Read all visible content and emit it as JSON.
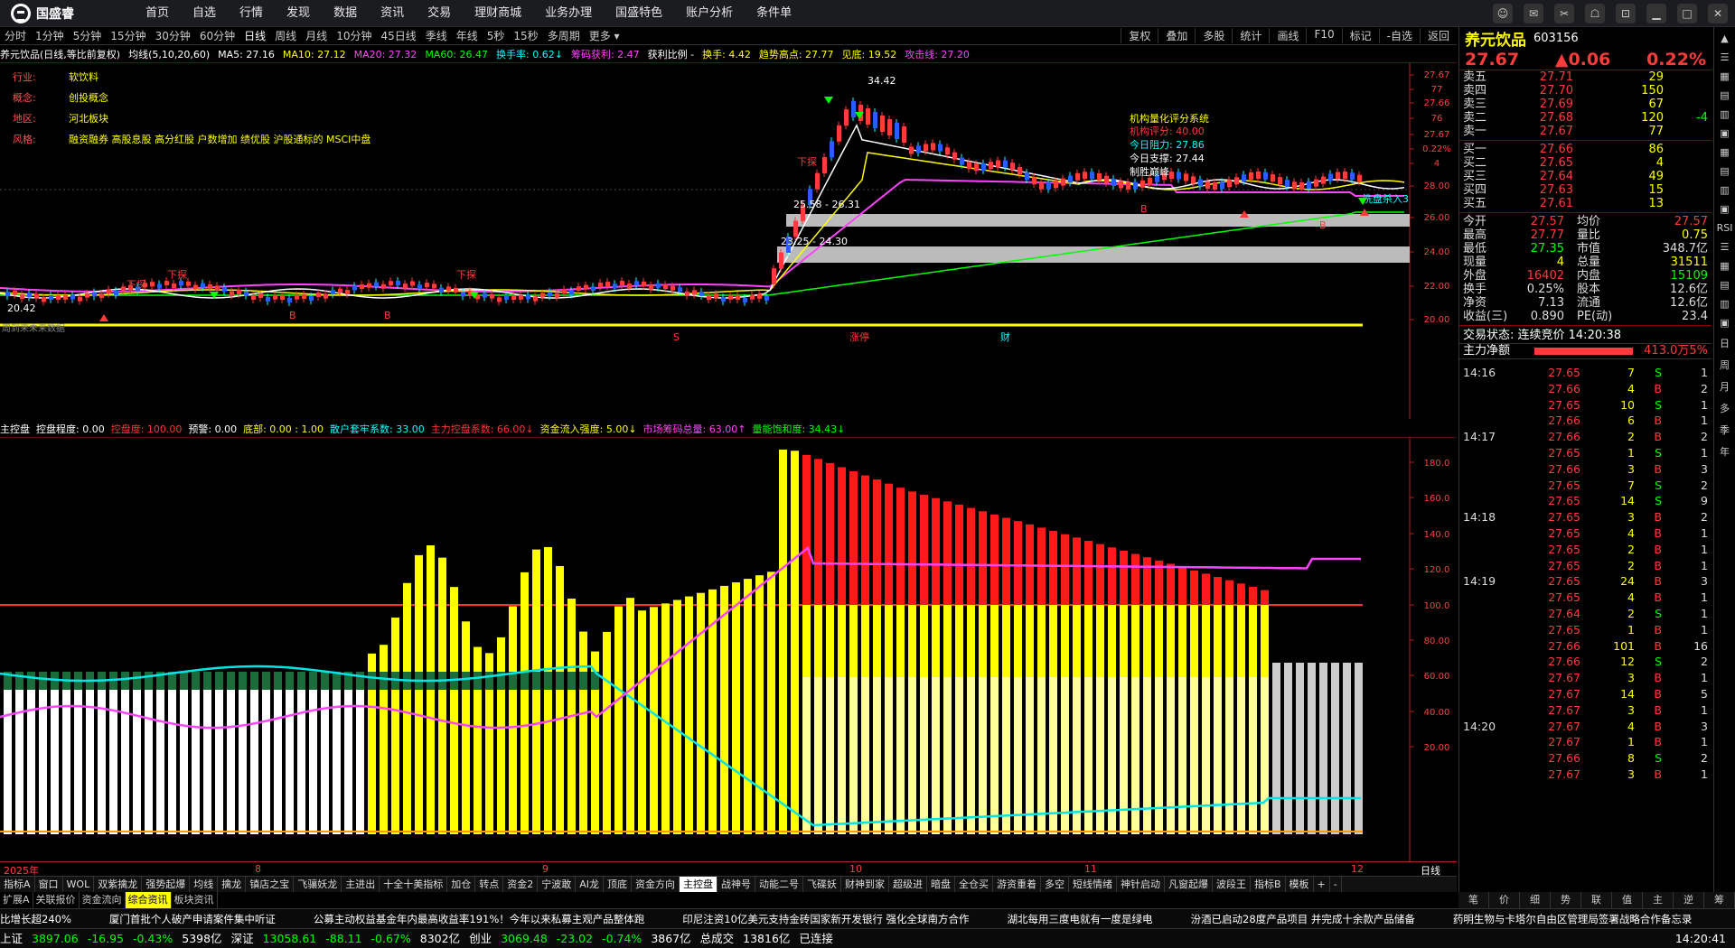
{
  "app": {
    "logo": "国盛睿",
    "menu": [
      "首页",
      "自选",
      "行情",
      "发现",
      "数据",
      "资讯",
      "交易",
      "理财商城",
      "业务办理",
      "国盛特色",
      "账户分析",
      "条件单"
    ]
  },
  "periods": {
    "left": [
      "分时",
      "1分钟",
      "5分钟",
      "15分钟",
      "30分钟",
      "60分钟",
      "日线",
      "周线",
      "月线",
      "10分钟",
      "45日线",
      "季线",
      "年线",
      "5秒",
      "15秒",
      "多周期",
      "更多 ▾"
    ],
    "active": "日线",
    "right": [
      "复权",
      "叠加",
      "多股",
      "统计",
      "画线",
      "F10",
      "标记",
      "-自选",
      "返回"
    ]
  },
  "kinfo": [
    {
      "t": "养元饮品(日线,等比前复权)",
      "c": "#ffffff"
    },
    {
      "t": "均线(5,10,20,60)",
      "c": "#ffffff"
    },
    {
      "t": "MA5: 27.16",
      "c": "#ffffff"
    },
    {
      "t": "MA10: 27.12",
      "c": "#ffff00"
    },
    {
      "t": "MA20: 27.32",
      "c": "#ff44ff"
    },
    {
      "t": "MA60: 26.47",
      "c": "#00ff00"
    },
    {
      "t": "换手率: 0.62↓",
      "c": "#00ffff"
    },
    {
      "t": "筹码获利: 2.47",
      "c": "#ff44ff"
    },
    {
      "t": "获利比例 -",
      "c": "#ffffff"
    },
    {
      "t": "换手: 4.42",
      "c": "#ffff00"
    },
    {
      "t": "趋势高点: 27.77",
      "c": "#ffff00"
    },
    {
      "t": "见底: 19.52",
      "c": "#ffff00"
    },
    {
      "t": "攻击线: 27.20",
      "c": "#ff44ff"
    }
  ],
  "stockmeta": [
    {
      "k": "行业:",
      "v": "软饮料"
    },
    {
      "k": "概念:",
      "v": "创投概念"
    },
    {
      "k": "地区:",
      "v": "河北板块"
    },
    {
      "k": "风格:",
      "v": "融资融券 高股息股 高分红股 户数增加 绩优股 沪股通标的 MSCI中盘"
    }
  ],
  "mainchart": {
    "yticks": [
      "27.67",
      "77",
      "27.66",
      "76",
      "27.67",
      "0.22%",
      "4",
      "28.00",
      "26.00",
      "24.00",
      "22.00",
      "20.00"
    ],
    "labels": {
      "high": "34.42",
      "low": "20.42",
      "zone1": "25.58 - 26.31",
      "zone2": "23.25 - 24.30",
      "eval_title": "机构量化评分系统",
      "eval1": "机构评分:   40.00",
      "eval2": "今日阻力:   27.86",
      "eval3": "今日支撑:   27.44",
      "eval4": "制胜巅峰",
      "killsig": "洗盘杀入3",
      "xia": "下探",
      "b": "B",
      "s": "S",
      "zhang": "涨停",
      "cai": "财",
      "bottom": "周到来未来数据"
    }
  },
  "subinfo": [
    {
      "t": "主控盘",
      "c": "#ffffff"
    },
    {
      "t": "控盘程度: 0.00",
      "c": "#ffffff"
    },
    {
      "t": "控盘度: 100.00",
      "c": "#ff3333"
    },
    {
      "t": "预警: 0.00",
      "c": "#ffffff"
    },
    {
      "t": "底部: 0.00 : 1.00",
      "c": "#ffff00"
    },
    {
      "t": "散户套牢系数: 33.00",
      "c": "#00ffff"
    },
    {
      "t": "主力控盘系数: 66.00↓",
      "c": "#ff3333"
    },
    {
      "t": "资金流入强度: 5.00↓",
      "c": "#ffff00"
    },
    {
      "t": "市场筹码总量: 63.00↑",
      "c": "#ff44ff"
    },
    {
      "t": "量能饱和度: 34.43↓",
      "c": "#00ff00"
    }
  ],
  "subchart": {
    "yticks": [
      "180.0",
      "160.0",
      "140.0",
      "120.0",
      "100.0",
      "80.00",
      "60.00",
      "40.00",
      "20.00"
    ]
  },
  "dates": [
    "2025年",
    "8",
    "9",
    "10",
    "11",
    "12"
  ],
  "datebar_right": "日线",
  "tabs": [
    "指标A",
    "窗口",
    "WOL",
    "双紫擒龙",
    "强势起爆",
    "均线",
    "擒龙",
    "镇店之宝",
    "飞骧妖龙",
    "主进出",
    "十全十美指标",
    "加仓",
    "转点",
    "资金2",
    "宁波敢",
    "AI龙",
    "顶底",
    "资金方向",
    "主控盘",
    "战神号",
    "动能二号",
    "飞碟妖",
    "财神到家",
    "超级进",
    "暗盘",
    "全仓买",
    "游资重着",
    "多空",
    "短线情绪",
    "神针启动",
    "凡窗起爆",
    "波段王",
    "指标B",
    "模板",
    "+",
    "-"
  ],
  "tabs_active": "主控盘",
  "tabs2": [
    "扩展A",
    "关联报价",
    "资金流向",
    "综合资讯",
    "板块资讯"
  ],
  "tabs2_active": "综合资讯",
  "news": [
    "比增长超240%",
    "厦门首批个人破产申请案件集中听证",
    "公募主动权益基金年内最高收益率191%！今年以来私募主观产品整体跑",
    "印尼注资10亿美元支持金砖国家新开发银行 强化全球南方合作",
    "湖北每用三度电就有一度是绿电",
    "汾酒已启动28度产品项目 并完成十余款产品储备",
    "药明生物与卡塔尔自由区管理局签署战略合作备忘录"
  ],
  "status": [
    {
      "t": "上证",
      "c": "#ffffff"
    },
    {
      "t": "3897.06",
      "c": "#00ff00"
    },
    {
      "t": "-16.95",
      "c": "#00ff00"
    },
    {
      "t": "-0.43%",
      "c": "#00ff00"
    },
    {
      "t": "5398亿",
      "c": "#ffffff"
    },
    {
      "t": "深证",
      "c": "#ffffff"
    },
    {
      "t": "13058.61",
      "c": "#00ff00"
    },
    {
      "t": "-88.11",
      "c": "#00ff00"
    },
    {
      "t": "-0.67%",
      "c": "#00ff00"
    },
    {
      "t": "8302亿",
      "c": "#ffffff"
    },
    {
      "t": "创业",
      "c": "#ffffff"
    },
    {
      "t": "3069.48",
      "c": "#00ff00"
    },
    {
      "t": "-23.02",
      "c": "#00ff00"
    },
    {
      "t": "-0.74%",
      "c": "#00ff00"
    },
    {
      "t": "3867亿",
      "c": "#ffffff"
    },
    {
      "t": "总成交",
      "c": "#ffffff"
    },
    {
      "t": "13816亿",
      "c": "#ffffff"
    },
    {
      "t": "已连接",
      "c": "#ffffff"
    }
  ],
  "status_time": "14:20:41",
  "quote": {
    "name": "养元饮品",
    "code": "603156",
    "price": "27.67",
    "change": "▲0.06",
    "pct": "0.22%",
    "asks": [
      {
        "l": "卖五",
        "p": "27.71",
        "v": "29",
        "c": ""
      },
      {
        "l": "卖四",
        "p": "27.70",
        "v": "150",
        "c": ""
      },
      {
        "l": "卖三",
        "p": "27.69",
        "v": "67",
        "c": ""
      },
      {
        "l": "卖二",
        "p": "27.68",
        "v": "120",
        "c": "-4"
      },
      {
        "l": "卖一",
        "p": "27.67",
        "v": "77",
        "c": ""
      }
    ],
    "bids": [
      {
        "l": "买一",
        "p": "27.66",
        "v": "86",
        "c": ""
      },
      {
        "l": "买二",
        "p": "27.65",
        "v": "4",
        "c": ""
      },
      {
        "l": "买三",
        "p": "27.64",
        "v": "49",
        "c": ""
      },
      {
        "l": "买四",
        "p": "27.63",
        "v": "15",
        "c": ""
      },
      {
        "l": "买五",
        "p": "27.61",
        "v": "13",
        "c": ""
      }
    ],
    "stats": [
      {
        "a": "今开",
        "b": "27.57",
        "bc": "#ff3b3b",
        "c": "均价",
        "d": "27.57",
        "dc": "#ff3b3b"
      },
      {
        "a": "最高",
        "b": "27.77",
        "bc": "#ff3b3b",
        "c": "量比",
        "d": "0.75",
        "dc": "#ffff00"
      },
      {
        "a": "最低",
        "b": "27.35",
        "bc": "#00ff00",
        "c": "市值",
        "d": "348.7亿",
        "dc": "#dddddd"
      },
      {
        "a": "现量",
        "b": "4",
        "bc": "#ffff00",
        "c": "总量",
        "d": "31511",
        "dc": "#ffff00"
      },
      {
        "a": "外盘",
        "b": "16402",
        "bc": "#ff3b3b",
        "c": "内盘",
        "d": "15109",
        "dc": "#00ff00"
      },
      {
        "a": "换手",
        "b": "0.25%",
        "bc": "#dddddd",
        "c": "股本",
        "d": "12.6亿",
        "dc": "#dddddd"
      },
      {
        "a": "净资",
        "b": "7.13",
        "bc": "#dddddd",
        "c": "流通",
        "d": "12.6亿",
        "dc": "#dddddd"
      },
      {
        "a": "收益(三)",
        "b": "0.890",
        "bc": "#dddddd",
        "c": "PE(动)",
        "d": "23.4",
        "dc": "#dddddd"
      }
    ],
    "trade_state": "交易状态: 连续竞价 14:20:38",
    "main_net_label": "主力净额",
    "main_net_value": "413.0万",
    "main_net_pct": "5%",
    "ticks": [
      {
        "t": "14:16",
        "p": "27.65",
        "v": "7",
        "s": "S",
        "n": "1"
      },
      {
        "t": "",
        "p": "27.66",
        "v": "4",
        "s": "B",
        "n": "2"
      },
      {
        "t": "",
        "p": "27.65",
        "v": "10",
        "s": "S",
        "n": "1"
      },
      {
        "t": "",
        "p": "27.66",
        "v": "6",
        "s": "B",
        "n": "1"
      },
      {
        "t": "14:17",
        "p": "27.66",
        "v": "2",
        "s": "B",
        "n": "2"
      },
      {
        "t": "",
        "p": "27.65",
        "v": "1",
        "s": "S",
        "n": "1"
      },
      {
        "t": "",
        "p": "27.66",
        "v": "3",
        "s": "B",
        "n": "3"
      },
      {
        "t": "",
        "p": "27.65",
        "v": "7",
        "s": "S",
        "n": "2"
      },
      {
        "t": "",
        "p": "27.65",
        "v": "14",
        "s": "S",
        "n": "9"
      },
      {
        "t": "14:18",
        "p": "27.65",
        "v": "3",
        "s": "B",
        "n": "2"
      },
      {
        "t": "",
        "p": "27.65",
        "v": "4",
        "s": "B",
        "n": "1"
      },
      {
        "t": "",
        "p": "27.65",
        "v": "2",
        "s": "B",
        "n": "1"
      },
      {
        "t": "",
        "p": "27.65",
        "v": "2",
        "s": "B",
        "n": "1"
      },
      {
        "t": "14:19",
        "p": "27.65",
        "v": "24",
        "s": "B",
        "n": "3"
      },
      {
        "t": "",
        "p": "27.65",
        "v": "4",
        "s": "B",
        "n": "1"
      },
      {
        "t": "",
        "p": "27.64",
        "v": "2",
        "s": "S",
        "n": "1"
      },
      {
        "t": "",
        "p": "27.65",
        "v": "1",
        "s": "B",
        "n": "1"
      },
      {
        "t": "",
        "p": "27.66",
        "v": "101",
        "s": "B",
        "n": "16"
      },
      {
        "t": "",
        "p": "27.66",
        "v": "12",
        "s": "S",
        "n": "2"
      },
      {
        "t": "",
        "p": "27.67",
        "v": "3",
        "s": "B",
        "n": "1"
      },
      {
        "t": "",
        "p": "27.67",
        "v": "14",
        "s": "B",
        "n": "5"
      },
      {
        "t": "",
        "p": "27.67",
        "v": "3",
        "s": "B",
        "n": "1"
      },
      {
        "t": "14:20",
        "p": "27.67",
        "v": "4",
        "s": "B",
        "n": "3"
      },
      {
        "t": "",
        "p": "27.67",
        "v": "1",
        "s": "B",
        "n": "1"
      },
      {
        "t": "",
        "p": "27.66",
        "v": "8",
        "s": "S",
        "n": "2"
      },
      {
        "t": "",
        "p": "27.67",
        "v": "3",
        "s": "B",
        "n": "1"
      }
    ],
    "tabs": [
      "笔",
      "价",
      "细",
      "势",
      "联",
      "值",
      "主",
      "逆",
      "筹"
    ]
  },
  "sidebar": [
    "▲",
    "☰",
    "▦",
    "▤",
    "▥",
    "▣",
    "▦",
    "▤",
    "▥",
    "▣",
    "RSI",
    "☰",
    "▦",
    "▤",
    "▥",
    "▣",
    "日",
    "周",
    "月",
    "多",
    "季",
    "年"
  ],
  "colors": {
    "up": "#ff3b3b",
    "down": "#00ff00",
    "accent": "#ffff00",
    "cyan": "#00ffff",
    "magenta": "#ff44ff"
  }
}
